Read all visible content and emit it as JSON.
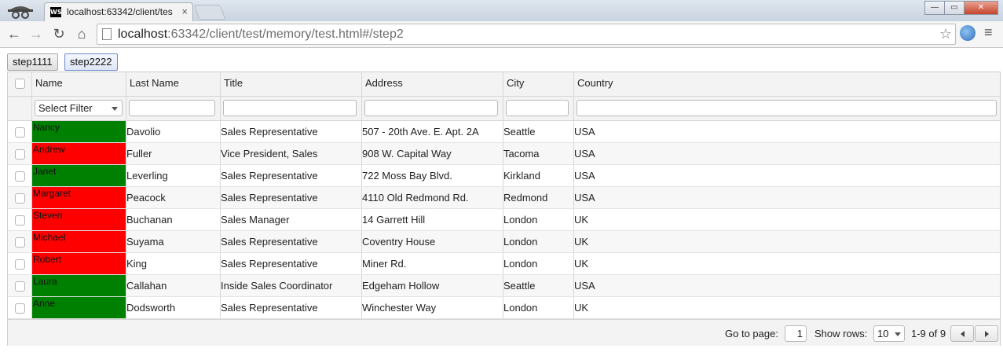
{
  "browser": {
    "tab_title": "localhost:63342/client/tes",
    "tab_icon_text": "WS",
    "close_tab": "×",
    "url_host": "localhost",
    "url_rest": ":63342/client/test/memory/test.html#/step2",
    "back": "←",
    "forward": "→",
    "reload": "↻",
    "home": "⌂",
    "star": "☆",
    "menu": "≡",
    "minimize": "—",
    "maximize": "▭",
    "close": "✕"
  },
  "steps": [
    "step1111",
    "step2222"
  ],
  "grid": {
    "columns": [
      "Name",
      "Last Name",
      "Title",
      "Address",
      "City",
      "Country"
    ],
    "name_filter_label": "Select Filter",
    "rows": [
      {
        "name": "Nancy",
        "name_status": "green",
        "last": "Davolio",
        "title": "Sales Representative",
        "address": "507 - 20th Ave. E. Apt. 2A",
        "city": "Seattle",
        "country": "USA"
      },
      {
        "name": "Andrew",
        "name_status": "red",
        "last": "Fuller",
        "title": "Vice President, Sales",
        "address": "908 W. Capital Way",
        "city": "Tacoma",
        "country": "USA"
      },
      {
        "name": "Janet",
        "name_status": "green",
        "last": "Leverling",
        "title": "Sales Representative",
        "address": "722 Moss Bay Blvd.",
        "city": "Kirkland",
        "country": "USA"
      },
      {
        "name": "Margaret",
        "name_status": "red",
        "last": "Peacock",
        "title": "Sales Representative",
        "address": "4110 Old Redmond Rd.",
        "city": "Redmond",
        "country": "USA"
      },
      {
        "name": "Steven",
        "name_status": "red",
        "last": "Buchanan",
        "title": "Sales Manager",
        "address": "14 Garrett Hill",
        "city": "London",
        "country": "UK"
      },
      {
        "name": "Michael",
        "name_status": "red",
        "last": "Suyama",
        "title": "Sales Representative",
        "address": "Coventry House",
        "city": "London",
        "country": "UK"
      },
      {
        "name": "Robert",
        "name_status": "red",
        "last": "King",
        "title": "Sales Representative",
        "address": "Miner Rd.",
        "city": "London",
        "country": "UK"
      },
      {
        "name": "Laura",
        "name_status": "green",
        "last": "Callahan",
        "title": "Inside Sales Coordinator",
        "address": "Edgeham Hollow",
        "city": "Seattle",
        "country": "USA"
      },
      {
        "name": "Anne",
        "name_status": "green",
        "last": "Dodsworth",
        "title": "Sales Representative",
        "address": "Winchester Way",
        "city": "London",
        "country": "UK"
      }
    ]
  },
  "pager": {
    "goto_label": "Go to page:",
    "page_value": "1",
    "show_rows_label": "Show rows:",
    "rows_value": "10",
    "range_text": "1-9 of 9"
  },
  "colors": {
    "status_green": "#008000",
    "status_red": "#ff0000"
  }
}
